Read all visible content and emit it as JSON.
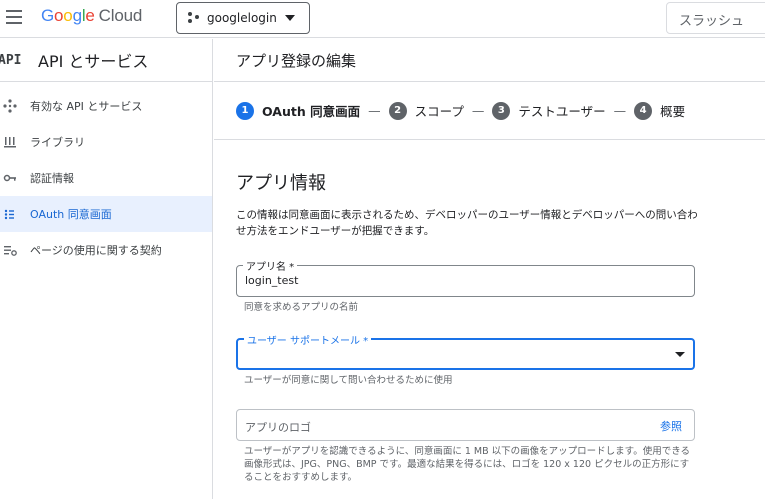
{
  "topbar": {
    "logo_letters": [
      "G",
      "o",
      "o",
      "g",
      "l",
      "e"
    ],
    "logo_suffix": "Cloud",
    "project_name": "googlelogin",
    "slash_button": "スラッシュ"
  },
  "sidebar": {
    "api_badge": "API",
    "title": "API とサービス",
    "items": [
      {
        "label": "有効な API とサービス",
        "icon": "api-services-icon"
      },
      {
        "label": "ライブラリ",
        "icon": "library-icon"
      },
      {
        "label": "認証情報",
        "icon": "key-icon"
      },
      {
        "label": "OAuth 同意画面",
        "icon": "oauth-consent-icon",
        "active": true
      },
      {
        "label": "ページの使用に関する契約",
        "icon": "settings-list-icon"
      }
    ]
  },
  "main": {
    "title": "アプリ登録の編集",
    "steps": [
      {
        "num": "1",
        "label": "OAuth 同意画面",
        "active": true
      },
      {
        "num": "2",
        "label": "スコープ"
      },
      {
        "num": "3",
        "label": "テストユーザー"
      },
      {
        "num": "4",
        "label": "概要"
      }
    ],
    "step_separator": "—",
    "section_title": "アプリ情報",
    "section_desc": "この情報は同意画面に表示されるため、デベロッパーのユーザー情報とデベロッパーへの問い合わせ方法をエンドユーザーが把握できます。",
    "app_name": {
      "label": "アプリ名 *",
      "value": "login_test",
      "helper": "同意を求めるアプリの名前"
    },
    "support_email": {
      "label": "ユーザー サポートメール *",
      "value": "",
      "helper": "ユーザーが同意に関して問い合わせるために使用"
    },
    "app_logo": {
      "placeholder": "アプリのロゴ",
      "browse": "参照",
      "helper": "ユーザーがアプリを認識できるように、同意画面に 1 MB 以下の画像をアップロードします。使用できる画像形式は、JPG、PNG、BMP です。最適な結果を得るには、ロゴを 120 x 120 ピクセルの正方形にすることをおすすめします。"
    }
  },
  "colors": {
    "accent": "#1a73e8",
    "active_bg": "#e8f0fe",
    "border": "#dadce0"
  }
}
